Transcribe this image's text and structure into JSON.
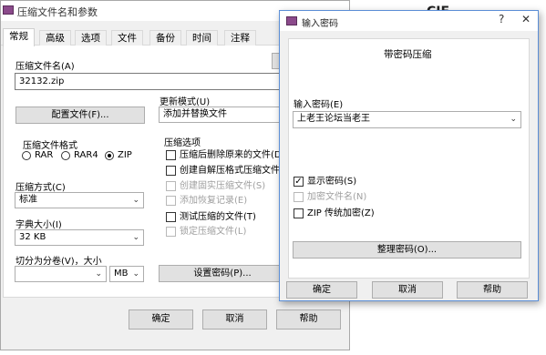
{
  "main_window": {
    "title": "压缩文件名和参数",
    "tabs": [
      "常规",
      "高级",
      "选项",
      "文件",
      "备份",
      "时间",
      "注释"
    ],
    "archive_name_label": "压缩文件名(A)",
    "archive_name_value": "32132.zip",
    "profiles_button": "配置文件(F)...",
    "update_mode_label": "更新模式(U)",
    "update_mode_value": "添加并替换文件",
    "format_label": "压缩文件格式",
    "formats": [
      "RAR",
      "RAR4",
      "ZIP"
    ],
    "selected_format": "ZIP",
    "method_label": "压缩方式(C)",
    "method_value": "标准",
    "dict_label": "字典大小(I)",
    "dict_value": "32 KB",
    "split_label": "切分为分卷(V)，大小",
    "split_value": "",
    "split_unit": "MB",
    "options_label": "压缩选项",
    "options": [
      {
        "label": "压缩后删除原来的文件(D",
        "checked": false,
        "disabled": false
      },
      {
        "label": "创建自解压格式压缩文件",
        "checked": false,
        "disabled": false
      },
      {
        "label": "创建固实压缩文件(S)",
        "checked": false,
        "disabled": true
      },
      {
        "label": "添加恢复记录(E)",
        "checked": false,
        "disabled": true
      },
      {
        "label": "测试压缩的文件(T)",
        "checked": false,
        "disabled": false
      },
      {
        "label": "锁定压缩文件(L)",
        "checked": false,
        "disabled": true
      }
    ],
    "set_password_button": "设置密码(P)...",
    "ok_button": "确定",
    "cancel_button": "取消",
    "help_button": "帮助",
    "bg_title_fragment": "CIF"
  },
  "password_dialog": {
    "title": "输入密码",
    "header": "带密码压缩",
    "enter_password_label": "输入密码(E)",
    "password_value": "上老王论坛当老王",
    "show_password_label": "显示密码(S)",
    "show_password_checked": true,
    "encrypt_names_label": "加密文件名(N)",
    "encrypt_names_disabled": true,
    "zip_legacy_label": "ZIP 传统加密(Z)",
    "zip_legacy_checked": false,
    "organize_button": "整理密码(O)...",
    "ok_button": "确定",
    "cancel_button": "取消",
    "help_button": "帮助"
  }
}
